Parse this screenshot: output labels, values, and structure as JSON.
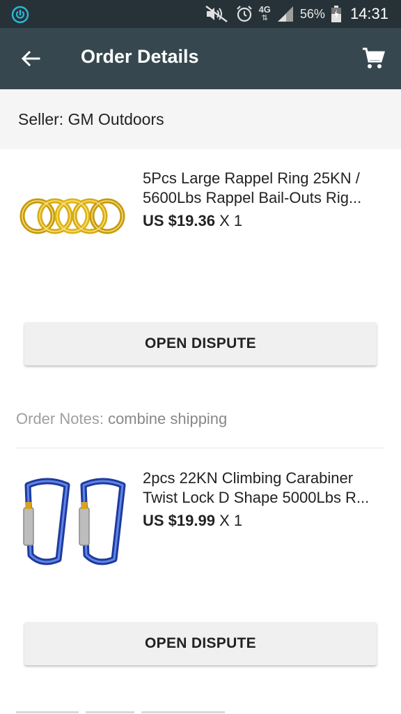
{
  "status_bar": {
    "app_icon": "power-icon",
    "network": "4G",
    "battery_percent": "56%",
    "time": "14:31"
  },
  "toolbar": {
    "title": "Order Details",
    "back_icon": "back-arrow-icon",
    "cart_icon": "cart-icon"
  },
  "seller": {
    "label": "Seller: GM Outdoors"
  },
  "items": [
    {
      "title_line1": "5Pcs Large Rappel Ring 25KN /",
      "title_line2": "5600Lbs Rappel Bail-Outs Rig...",
      "price": "US $19.36",
      "quantity": "X 1",
      "button": "OPEN DISPUTE"
    },
    {
      "title_line1": "2pcs 22KN Climbing Carabiner",
      "title_line2": "Twist Lock D Shape 5000Lbs R...",
      "price": "US $19.99",
      "quantity": "X 1",
      "button": "OPEN DISPUTE"
    }
  ],
  "order_notes": {
    "label": "Order Notes:",
    "value": "combine shipping"
  },
  "colors": {
    "status_bar": "#263238",
    "toolbar": "#37474f",
    "seller_bg": "#f5f5f5",
    "button_bg": "#f0f0f0",
    "ring_gold": "#e0b515",
    "carabiner_blue": "#2f4fb8"
  }
}
